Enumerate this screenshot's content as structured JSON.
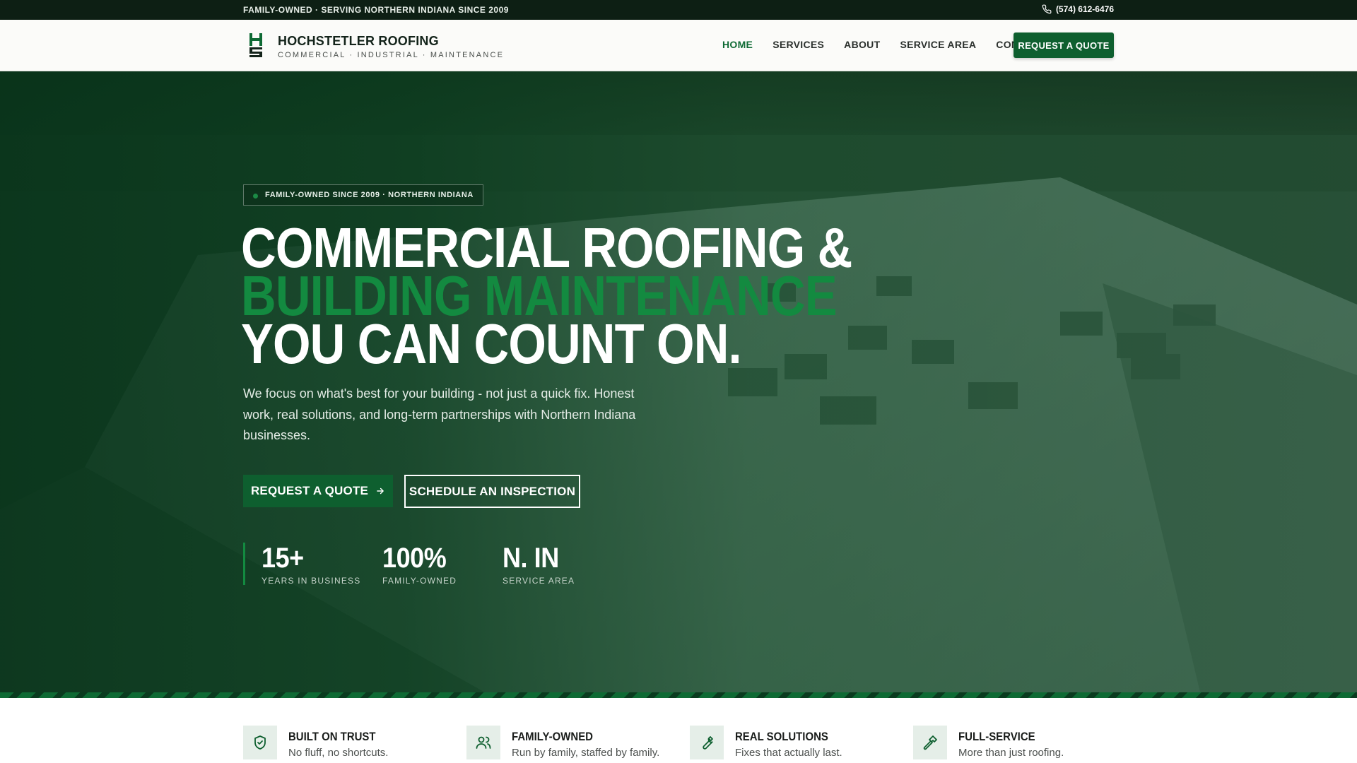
{
  "topbar": {
    "tagline": "FAMILY-OWNED · SERVING NORTHERN INDIANA SINCE 2009",
    "phone": "(574) 612-6476",
    "phone_icon": "phone-icon"
  },
  "header": {
    "logo_icon": "hs-logo-icon",
    "brand_name": "HOCHSTETLER ROOFING",
    "brand_sub": "COMMERCIAL · INDUSTRIAL · MAINTENANCE",
    "nav": [
      {
        "label": "HOME",
        "active": true
      },
      {
        "label": "SERVICES",
        "active": false
      },
      {
        "label": "ABOUT",
        "active": false
      },
      {
        "label": "SERVICE AREA",
        "active": false
      },
      {
        "label": "CONTACT",
        "active": false
      }
    ],
    "cta": "REQUEST A QUOTE"
  },
  "hero": {
    "badge": "FAMILY-OWNED SINCE 2009 · NORTHERN INDIANA",
    "headline_line1": "COMMERCIAL ROOFING &",
    "headline_line2": "BUILDING MAINTENANCE",
    "headline_line3": "YOU CAN COUNT ON.",
    "lead": "We focus on what's best for your building - not just a quick fix. Honest work, real solutions, and long-term partnerships with Northern Indiana businesses.",
    "primary_button": "REQUEST A QUOTE",
    "primary_button_icon": "arrow-right-icon",
    "secondary_button": "SCHEDULE AN INSPECTION",
    "stats": [
      {
        "value": "15+",
        "label": "YEARS IN BUSINESS"
      },
      {
        "value": "100%",
        "label": "FAMILY-OWNED"
      },
      {
        "value": "N. IN",
        "label": "SERVICE AREA"
      }
    ]
  },
  "features": [
    {
      "icon": "shield-check-icon",
      "title": "BUILT ON TRUST",
      "subtitle": "No fluff, no shortcuts."
    },
    {
      "icon": "users-icon",
      "title": "FAMILY-OWNED",
      "subtitle": "Run by family, staffed by family."
    },
    {
      "icon": "wrench-icon",
      "title": "REAL SOLUTIONS",
      "subtitle": "Fixes that actually last."
    },
    {
      "icon": "hammer-icon",
      "title": "FULL-SERVICE",
      "subtitle": "More than just roofing."
    }
  ],
  "colors": {
    "brand_green": "#0e5f2f",
    "accent_green": "#138a40",
    "topbar_bg": "#0d1f14"
  }
}
